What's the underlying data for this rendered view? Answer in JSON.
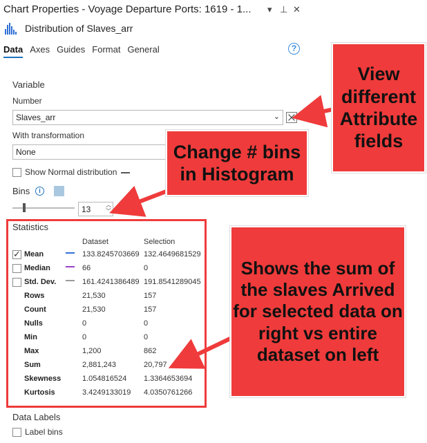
{
  "window": {
    "title": "Chart Properties - Voyage Departure Ports: 1619 - 1...",
    "subtitle": "Distribution of Slaves_arr",
    "pin_glyph": "⊥",
    "close_glyph": "✕",
    "menu_glyph": "▾"
  },
  "tabs": [
    {
      "label": "Data",
      "active": true
    },
    {
      "label": "Axes"
    },
    {
      "label": "Guides"
    },
    {
      "label": "Format"
    },
    {
      "label": "General"
    }
  ],
  "help_glyph": "?",
  "variable": {
    "heading": "Variable",
    "number_label": "Number",
    "number_value": "Slaves_arr",
    "transform_label": "With transformation",
    "transform_value": "None",
    "show_normal_label": "Show Normal distribution"
  },
  "bins": {
    "label": "Bins",
    "value": "13",
    "info_glyph": "i"
  },
  "statistics": {
    "heading": "Statistics",
    "col_dataset": "Dataset",
    "col_selection": "Selection",
    "rows": [
      {
        "name": "Mean",
        "dataset": "133.8245703669",
        "selection": "132.4649681529",
        "checkbox": true,
        "checked": true,
        "line_color": "#2f6fd6"
      },
      {
        "name": "Median",
        "dataset": "66",
        "selection": "0",
        "checkbox": true,
        "checked": false,
        "line_color": "#9b3fc9"
      },
      {
        "name": "Std. Dev.",
        "dataset": "161.4241386489",
        "selection": "191.8541289045",
        "checkbox": true,
        "checked": false,
        "line_color": "#9a9a9a"
      },
      {
        "name": "Rows",
        "dataset": "21,530",
        "selection": "157"
      },
      {
        "name": "Count",
        "dataset": "21,530",
        "selection": "157"
      },
      {
        "name": "Nulls",
        "dataset": "0",
        "selection": "0"
      },
      {
        "name": "Min",
        "dataset": "0",
        "selection": "0"
      },
      {
        "name": "Max",
        "dataset": "1,200",
        "selection": "862"
      },
      {
        "name": "Sum",
        "dataset": "2,881,243",
        "selection": "20,797"
      },
      {
        "name": "Skewness",
        "dataset": "1.054816524",
        "selection": "1.3364653694"
      },
      {
        "name": "Kurtosis",
        "dataset": "3.4249133019",
        "selection": "4.0350761266"
      }
    ]
  },
  "data_labels": {
    "heading": "Data Labels",
    "label_bins": "Label bins"
  },
  "callouts": {
    "view": "View different Attribute fields",
    "bins": "Change # bins in Histogram",
    "sum": "Shows the sum of the slaves Arrived for selected data on right vs entire dataset on left"
  },
  "colors": {
    "callout": "#ef3b3b",
    "accent": "#1e73be"
  }
}
